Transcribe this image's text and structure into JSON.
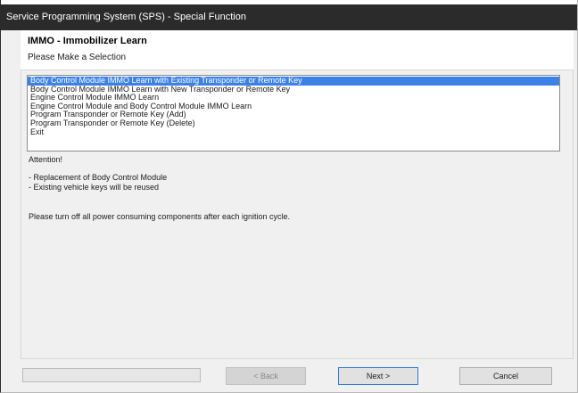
{
  "window": {
    "title": "Service Programming System (SPS) - Special Function"
  },
  "header": {
    "title": "IMMO - Immobilizer Learn",
    "subtitle": "Please Make a Selection"
  },
  "selection_list": {
    "selected_index": 0,
    "items": [
      "Body Control Module IMMO Learn with Existing Transponder or Remote Key",
      "Body Control Module IMMO Learn with New Transponder or Remote Key",
      "Engine Control Module IMMO Learn",
      "Engine Control Module and Body Control Module IMMO Learn",
      "Program Transponder or Remote Key (Add)",
      "Program Transponder or Remote Key (Delete)",
      "Exit"
    ]
  },
  "info": {
    "attention": "Attention!",
    "notes": [
      "- Replacement of Body Control Module",
      "- Existing vehicle keys will be reused"
    ],
    "instruction": "Please turn off all power consuming components after each ignition cycle."
  },
  "progress": {
    "value_percent": 0
  },
  "buttons": {
    "back": "< Back",
    "next": "Next >",
    "cancel": "Cancel"
  },
  "colors": {
    "titlebar": "#2b2b2b",
    "selection": "#3c82e6",
    "window_bg": "#f0f0f0",
    "default_button_border": "#2f7bd8"
  }
}
